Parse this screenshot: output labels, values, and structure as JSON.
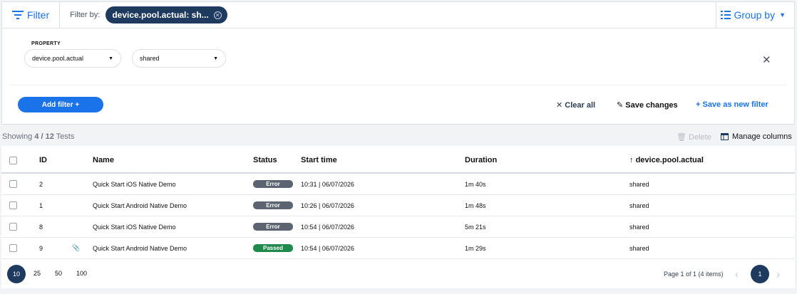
{
  "topbar": {
    "filter_label": "Filter",
    "filter_by_label": "Filter by:",
    "chip_label": "device.pool.actual: sh...",
    "group_by_label": "Group by"
  },
  "panel": {
    "property_label": "PROPERTY",
    "property_value": "device.pool.actual",
    "value_value": "shared",
    "add_filter_label": "Add filter +",
    "clear_all_label": "Clear all",
    "save_changes_label": "Save changes",
    "save_new_label": "+ Save as new filter"
  },
  "summary": {
    "showing_prefix": "Showing",
    "shown": "4",
    "sep": "/",
    "total": "12",
    "suffix": "Tests",
    "delete_label": "Delete",
    "manage_columns_label": "Manage columns"
  },
  "table": {
    "headers": {
      "id": "ID",
      "name": "Name",
      "status": "Status",
      "start": "Start time",
      "duration": "Duration",
      "pool": "device.pool.actual"
    },
    "rows": [
      {
        "id": "2",
        "name": "Quick Start iOS Native Demo",
        "status": "Error",
        "start": "10:31 | 06/07/2026",
        "duration": "1m 40s",
        "pool": "shared"
      },
      {
        "id": "1",
        "name": "Quick Start Android Native Demo",
        "status": "Error",
        "start": "10:26 | 06/07/2026",
        "duration": "1m 48s",
        "pool": "shared"
      },
      {
        "id": "8",
        "name": "Quick Start iOS Native Demo",
        "status": "Error",
        "start": "10:54 | 06/07/2026",
        "duration": "5m 21s",
        "pool": "shared"
      },
      {
        "id": "9",
        "name": "Quick Start Android Native Demo",
        "status": "Passed",
        "start": "10:54 | 06/07/2026",
        "duration": "1m 29s",
        "pool": "shared",
        "has_attachment": true
      }
    ]
  },
  "pager": {
    "sizes": [
      "10",
      "25",
      "50",
      "100"
    ],
    "info": "Page 1 of 1 (4 items)",
    "current": "1"
  },
  "colors": {
    "accent": "#1a73e8",
    "navy": "#1e3a5f",
    "error": "#5b6470",
    "passed": "#1f8a4c"
  }
}
